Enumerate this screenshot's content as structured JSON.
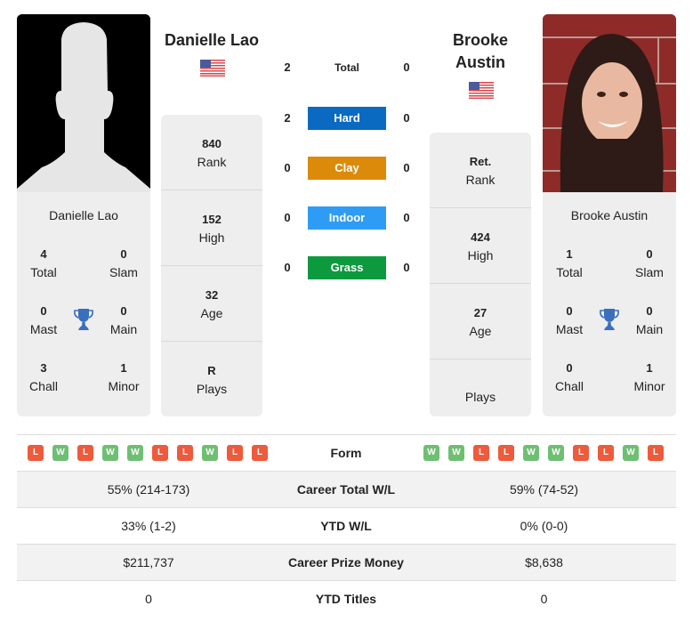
{
  "player_left": {
    "name": "Danielle Lao",
    "country_flag": "us-flag-icon",
    "photo": "silhouette-placeholder",
    "titles": {
      "total": {
        "value": "4",
        "label": "Total"
      },
      "slam": {
        "value": "0",
        "label": "Slam"
      },
      "mast": {
        "value": "0",
        "label": "Mast"
      },
      "main": {
        "value": "0",
        "label": "Main"
      },
      "chall": {
        "value": "3",
        "label": "Chall"
      },
      "minor": {
        "value": "1",
        "label": "Minor"
      }
    },
    "stats": [
      {
        "value": "840",
        "label": "Rank"
      },
      {
        "value": "152",
        "label": "High"
      },
      {
        "value": "32",
        "label": "Age"
      },
      {
        "value": "R",
        "label": "Plays"
      }
    ],
    "form": [
      "L",
      "W",
      "L",
      "W",
      "W",
      "L",
      "L",
      "W",
      "L",
      "L"
    ]
  },
  "player_right": {
    "name_line1": "Brooke",
    "name_line2": "Austin",
    "name": "Brooke Austin",
    "country_flag": "us-flag-icon",
    "photo": "player-photo",
    "titles": {
      "total": {
        "value": "1",
        "label": "Total"
      },
      "slam": {
        "value": "0",
        "label": "Slam"
      },
      "mast": {
        "value": "0",
        "label": "Mast"
      },
      "main": {
        "value": "0",
        "label": "Main"
      },
      "chall": {
        "value": "0",
        "label": "Chall"
      },
      "minor": {
        "value": "1",
        "label": "Minor"
      }
    },
    "stats": [
      {
        "value": "Ret.",
        "label": "Rank"
      },
      {
        "value": "424",
        "label": "High"
      },
      {
        "value": "27",
        "label": "Age"
      },
      {
        "value": "",
        "label": "Plays"
      }
    ],
    "form": [
      "W",
      "W",
      "L",
      "L",
      "W",
      "W",
      "L",
      "L",
      "W",
      "L"
    ]
  },
  "h2h": [
    {
      "label": "Total",
      "left": "2",
      "right": "0",
      "color": null
    },
    {
      "label": "Hard",
      "left": "2",
      "right": "0",
      "color": "#0a6ac2"
    },
    {
      "label": "Clay",
      "left": "0",
      "right": "0",
      "color": "#dc8a0a"
    },
    {
      "label": "Indoor",
      "left": "0",
      "right": "0",
      "color": "#2e9cf5"
    },
    {
      "label": "Grass",
      "left": "0",
      "right": "0",
      "color": "#0d9a3e"
    }
  ],
  "comparison": {
    "form_label": "Form",
    "rows": [
      {
        "label": "Career Total W/L",
        "left": "55% (214-173)",
        "right": "59% (74-52)"
      },
      {
        "label": "YTD W/L",
        "left": "33% (1-2)",
        "right": "0% (0-0)"
      },
      {
        "label": "Career Prize Money",
        "left": "$211,737",
        "right": "$8,638"
      },
      {
        "label": "YTD Titles",
        "left": "0",
        "right": "0"
      }
    ]
  },
  "colors": {
    "win": "#6fbf73",
    "loss": "#ee5a3c",
    "trophy": "#3a6fbf",
    "card_bg": "#eeeeee"
  }
}
